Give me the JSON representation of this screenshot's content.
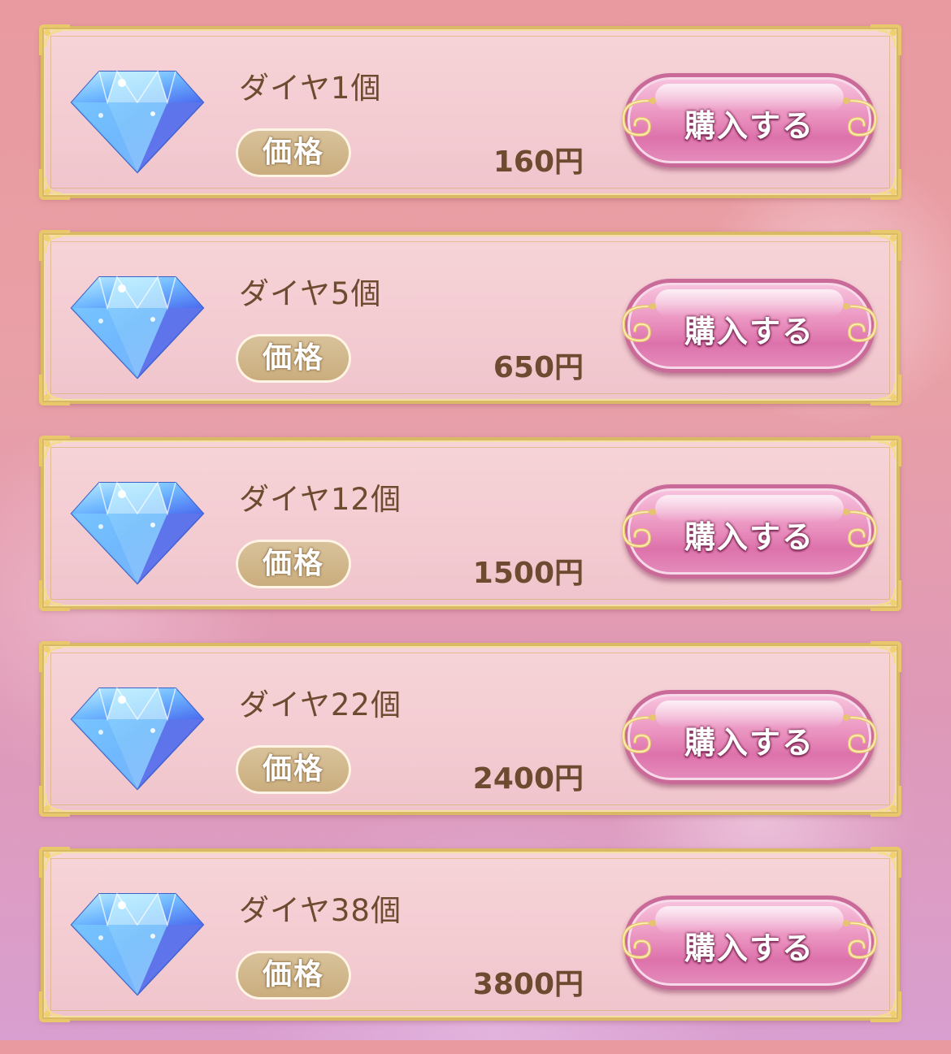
{
  "shop": {
    "price_label": "価格",
    "buy_label": "購入する",
    "items": [
      {
        "title": "ダイヤ1個",
        "price": "160円"
      },
      {
        "title": "ダイヤ5個",
        "price": "650円"
      },
      {
        "title": "ダイヤ12個",
        "price": "1500円"
      },
      {
        "title": "ダイヤ22個",
        "price": "2400円"
      },
      {
        "title": "ダイヤ38個",
        "price": "3800円"
      }
    ]
  },
  "icons": {
    "item": "diamond-icon",
    "button_ornament": "flourish-ornament"
  },
  "colors": {
    "frame_gold": "#d9b866",
    "button_pink": "#e58dbc",
    "text_brown": "#6e4a30",
    "badge_tan": "#c9ac7c"
  }
}
